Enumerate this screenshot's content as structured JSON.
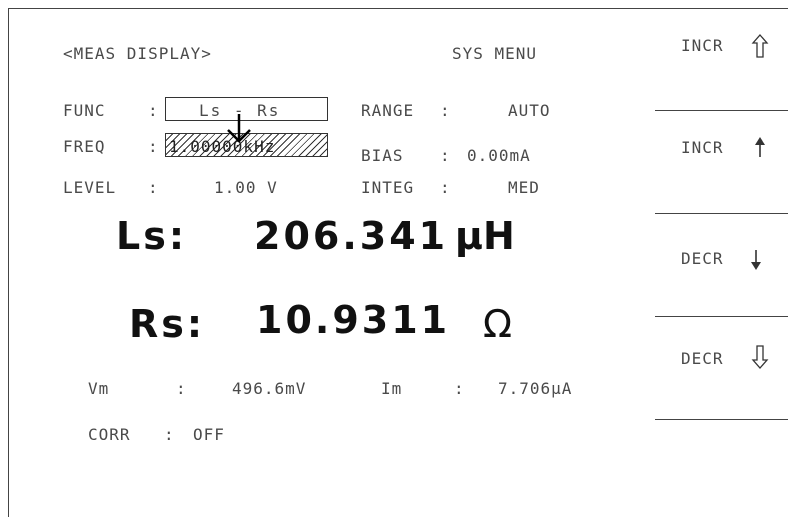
{
  "header": {
    "title": "<MEAS DISPLAY>",
    "sys_menu": "SYS MENU"
  },
  "params": {
    "func_label": "FUNC",
    "func_value": "Ls - Rs",
    "freq_label": "FREQ",
    "freq_value": "1.00000kHz",
    "level_label": "LEVEL",
    "level_value": "1.00 V",
    "range_label": "RANGE",
    "range_value": "AUTO",
    "bias_label": "BIAS",
    "bias_value": "0.00mA",
    "integ_label": "INTEG",
    "integ_value": "MED",
    "colon": ":"
  },
  "measurement": {
    "primary_label": "Ls:",
    "primary_value": "206.341",
    "primary_unit": "μH",
    "secondary_label": "Rs:",
    "secondary_value": "10.9311",
    "secondary_unit": "Ω"
  },
  "monitor": {
    "vm_label": "Vm",
    "vm_value": "496.6mV",
    "im_label": "Im",
    "im_value": "7.706μA",
    "corr_label": "CORR",
    "corr_value": "OFF"
  },
  "softkeys": [
    {
      "label": "INCR",
      "icon": "double-up-arrow-icon"
    },
    {
      "label": "INCR",
      "icon": "up-arrow-icon"
    },
    {
      "label": "DECR",
      "icon": "down-arrow-icon"
    },
    {
      "label": "DECR",
      "icon": "double-down-arrow-icon"
    }
  ]
}
